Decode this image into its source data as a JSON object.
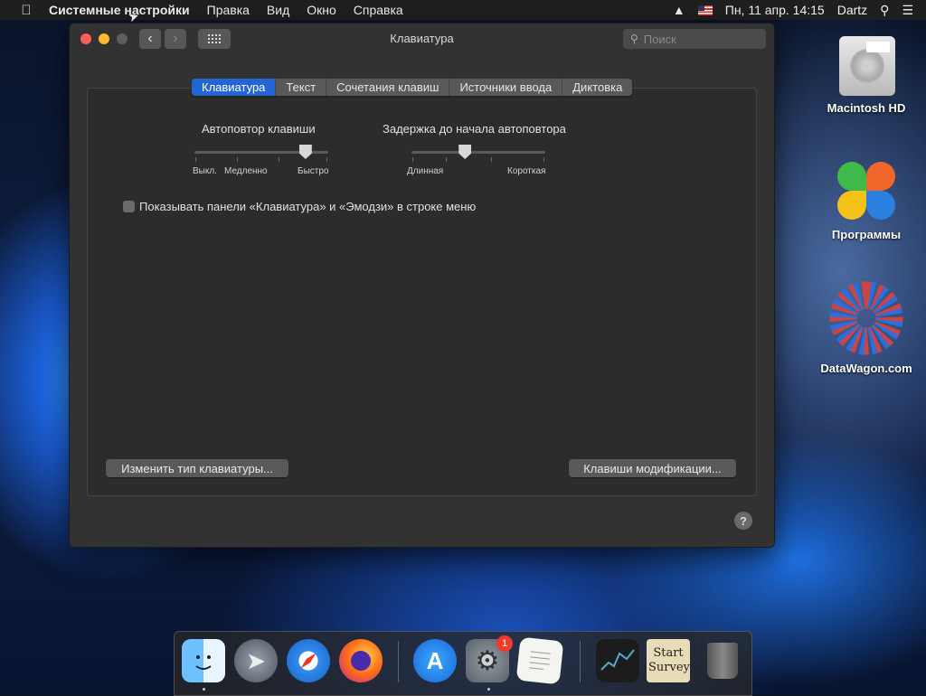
{
  "menubar": {
    "apple": "",
    "items": [
      "Системные настройки",
      "Правка",
      "Вид",
      "Окно",
      "Справка"
    ],
    "datetime": "Пн, 11 апр.  14:15",
    "user": "Dartz"
  },
  "window": {
    "title": "Клавиатура",
    "search_placeholder": "Поиск",
    "tabs": [
      "Клавиатура",
      "Текст",
      "Сочетания клавиш",
      "Источники ввода",
      "Диктовка"
    ],
    "active_tab": 0,
    "key_repeat": {
      "label": "Автоповтор клавиши",
      "left": "Выкл.",
      "mid": "Медленно",
      "right": "Быстро",
      "level": 0.83
    },
    "repeat_delay": {
      "label": "Задержка до начала автоповтора",
      "left": "Длинная",
      "right": "Короткая",
      "level": 0.4
    },
    "show_menu_checkbox": "Показывать панели «Клавиатура» и «Эмодзи» в строке меню",
    "show_menu_checked": false,
    "btn_change_type": "Изменить тип клавиатуры...",
    "btn_modifier_keys": "Клавиши модификации...",
    "help": "?"
  },
  "desktop": {
    "icons": [
      {
        "label": "Macintosh HD",
        "icon": "hard-drive-icon"
      },
      {
        "label": "Программы",
        "icon": "apps-flower-icon"
      },
      {
        "label": "DataWagon.com",
        "icon": "datawagon-icon"
      }
    ]
  },
  "dock": {
    "items": [
      {
        "name": "finder",
        "running": true
      },
      {
        "name": "launchpad",
        "running": false
      },
      {
        "name": "safari",
        "running": false
      },
      {
        "name": "firefox",
        "running": false
      },
      {
        "name": "app-store",
        "running": false
      },
      {
        "name": "system-preferences",
        "running": true,
        "badge": "1"
      },
      {
        "name": "textedit",
        "running": false
      },
      {
        "name": "stocks-widget",
        "running": false
      },
      {
        "name": "start-survey",
        "running": false,
        "note": "Start Survey"
      },
      {
        "name": "trash",
        "running": false
      }
    ]
  },
  "colors": {
    "accent": "#2366d1",
    "close": "#fc5f57",
    "minimize": "#fdbc2e",
    "badge": "#f03a2e"
  }
}
